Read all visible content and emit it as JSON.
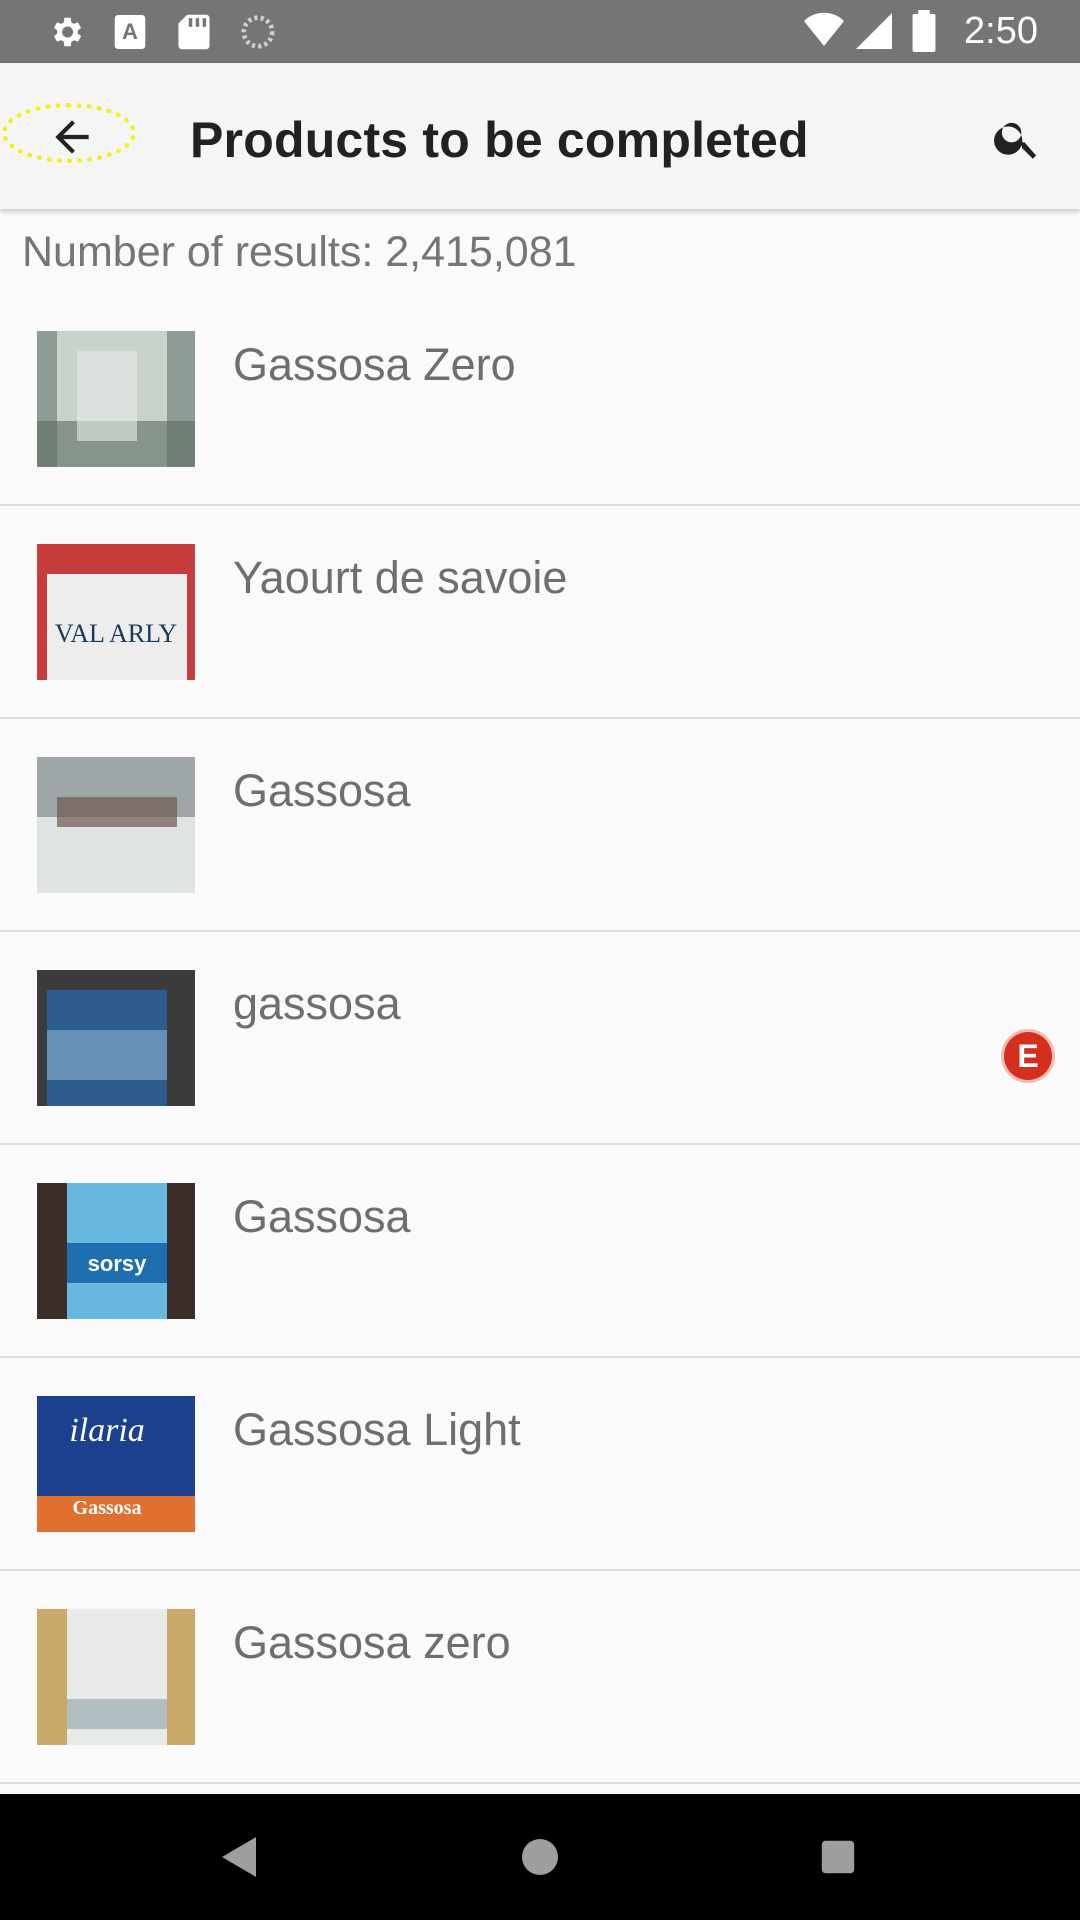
{
  "status_bar": {
    "time": "2:50",
    "left_icons": [
      "settings-icon",
      "keyboard-a-icon",
      "sd-card-icon",
      "sync-icon"
    ],
    "right_icons": [
      "wifi-icon",
      "signal-icon",
      "battery-icon"
    ]
  },
  "app_bar": {
    "title": "Products to be completed",
    "back_icon": "arrow-back-icon",
    "search_icon": "search-icon"
  },
  "results": {
    "label": "Number of results: 2,415,081"
  },
  "products": [
    {
      "name": "Gassosa Zero",
      "thumb_colors": [
        "#8f9c95",
        "#c9d2cb",
        "#5b6b5f"
      ],
      "badge": ""
    },
    {
      "name": "Yaourt de savoie",
      "thumb_colors": [
        "#c73d3d",
        "#ededed",
        "#1a3a5a"
      ],
      "badge": ""
    },
    {
      "name": "Gassosa",
      "thumb_colors": [
        "#9ea6a8",
        "#dfe3e2",
        "#6d5a52"
      ],
      "badge": ""
    },
    {
      "name": "gassosa",
      "thumb_colors": [
        "#2c5b8c",
        "#7fa6c8",
        "#3b3b3b"
      ],
      "badge": "E"
    },
    {
      "name": "Gassosa",
      "thumb_colors": [
        "#3a2f2a",
        "#68b8e0",
        "#1e6fb0"
      ],
      "badge": ""
    },
    {
      "name": "Gassosa Light",
      "thumb_colors": [
        "#1c3f8e",
        "#e07030",
        "#ffffff"
      ],
      "badge": ""
    },
    {
      "name": "Gassosa zero",
      "thumb_colors": [
        "#c9a86a",
        "#e8eae8",
        "#8aa0a8"
      ],
      "badge": ""
    }
  ],
  "nav_bar": {
    "icons": [
      "nav-back-icon",
      "nav-home-icon",
      "nav-recents-icon"
    ]
  }
}
